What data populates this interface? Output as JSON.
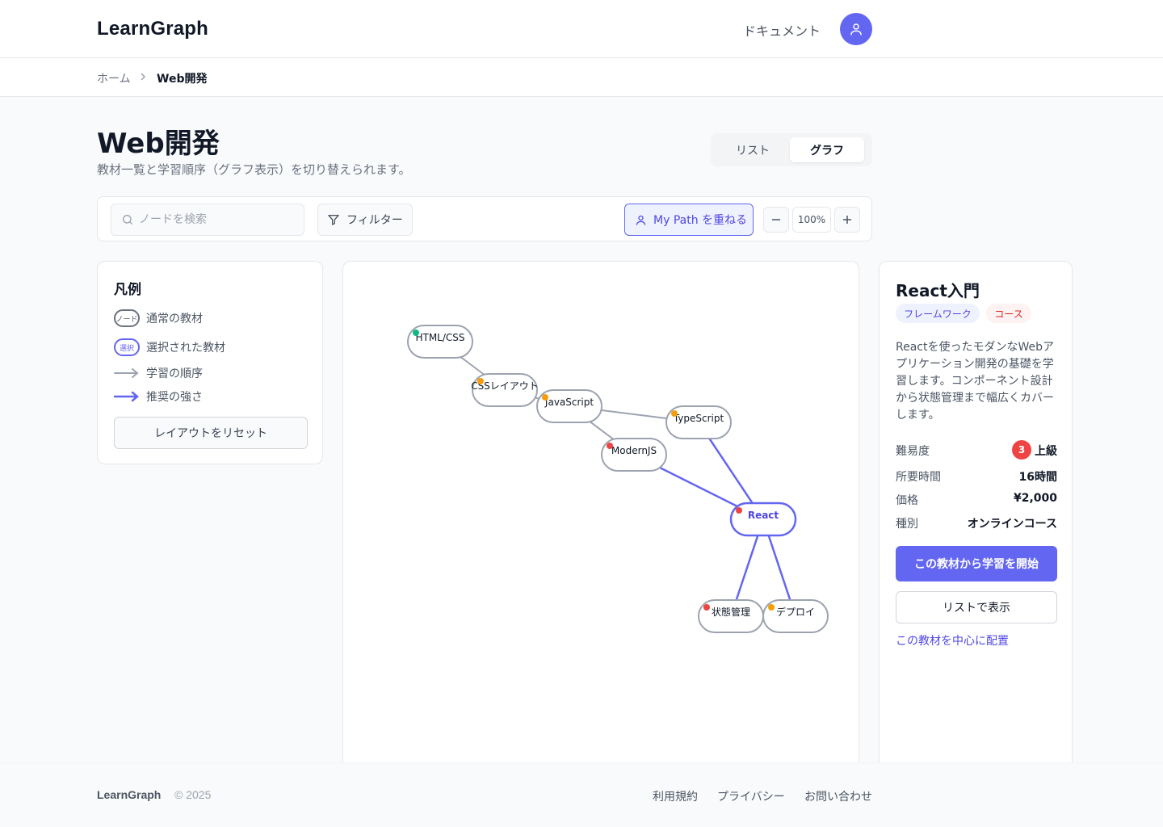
{
  "header": {
    "logo": "LearnGraph",
    "docs_link": "ドキュメント",
    "avatar_icon": "user-icon"
  },
  "breadcrumb": {
    "home": "ホーム",
    "current": "Web開発"
  },
  "page": {
    "title": "Web開発",
    "subtitle": "教材一覧と学習順序（グラフ表示）を切り替えられます。",
    "view_toggle": {
      "list": "リスト",
      "graph": "グラフ",
      "active": "graph"
    }
  },
  "toolbar": {
    "search_placeholder": "ノードを検索",
    "filter_label": "フィルター",
    "mypath_label": "My Path を重ねる",
    "zoom_level": "100%"
  },
  "legend": {
    "title": "凡例",
    "items": [
      {
        "sample": "ノード",
        "label": "通常の教材"
      },
      {
        "sample": "選択",
        "label": "選択された教材"
      },
      {
        "label": "学習の順序"
      },
      {
        "label": "推奨の強さ"
      }
    ],
    "reset_label": "レイアウトをリセット"
  },
  "graph": {
    "nodes": [
      {
        "id": "html",
        "label": "HTML/CSS",
        "difficulty_color": "#10b981",
        "selected": false
      },
      {
        "id": "css",
        "label": "CSSレイアウト",
        "difficulty_color": "#f59e0b",
        "selected": false
      },
      {
        "id": "js",
        "label": "JavaScript",
        "difficulty_color": "#f59e0b",
        "selected": false
      },
      {
        "id": "ts",
        "label": "TypeScript",
        "difficulty_color": "#f59e0b",
        "selected": false
      },
      {
        "id": "modern",
        "label": "ModernJS",
        "difficulty_color": "#ef4444",
        "selected": false
      },
      {
        "id": "react",
        "label": "React",
        "difficulty_color": "#ef4444",
        "selected": true
      },
      {
        "id": "state",
        "label": "状態管理",
        "difficulty_color": "#ef4444",
        "selected": false
      },
      {
        "id": "deploy",
        "label": "デプロイ",
        "difficulty_color": "#f59e0b",
        "selected": false
      }
    ],
    "edges": [
      {
        "from": "html",
        "to": "css",
        "recommended": false
      },
      {
        "from": "css",
        "to": "js",
        "recommended": false
      },
      {
        "from": "js",
        "to": "ts",
        "recommended": false
      },
      {
        "from": "js",
        "to": "modern",
        "recommended": false
      },
      {
        "from": "modern",
        "to": "react",
        "recommended": true
      },
      {
        "from": "ts",
        "to": "react",
        "recommended": true
      },
      {
        "from": "react",
        "to": "state",
        "recommended": true
      },
      {
        "from": "react",
        "to": "deploy",
        "recommended": true
      }
    ],
    "colors": {
      "edge": "#9ca3af",
      "recommended": "#6366f1",
      "node_border": "#9ca3af",
      "selected": "#6366f1"
    }
  },
  "detail": {
    "title": "React入門",
    "tags": [
      "フレームワーク",
      "コース"
    ],
    "description": "Reactを使ったモダンなWebアプリケーション開発の基礎を学習します。コンポーネント設計から状態管理まで幅広くカバーします。",
    "difficulty": {
      "label": "難易度",
      "level": "3",
      "value": "上級"
    },
    "duration": {
      "label": "所要時間",
      "value": "16時間"
    },
    "price": {
      "label": "価格",
      "value": "¥2,000"
    },
    "type": {
      "label": "種別",
      "value": "オンラインコース"
    },
    "start_label": "この教材から学習を開始",
    "list_label": "リストで表示",
    "center_label": "この教材を中心に配置"
  },
  "footer": {
    "logo": "LearnGraph",
    "copyright": "© 2025",
    "links": [
      "利用規約",
      "プライバシー",
      "お問い合わせ"
    ]
  }
}
